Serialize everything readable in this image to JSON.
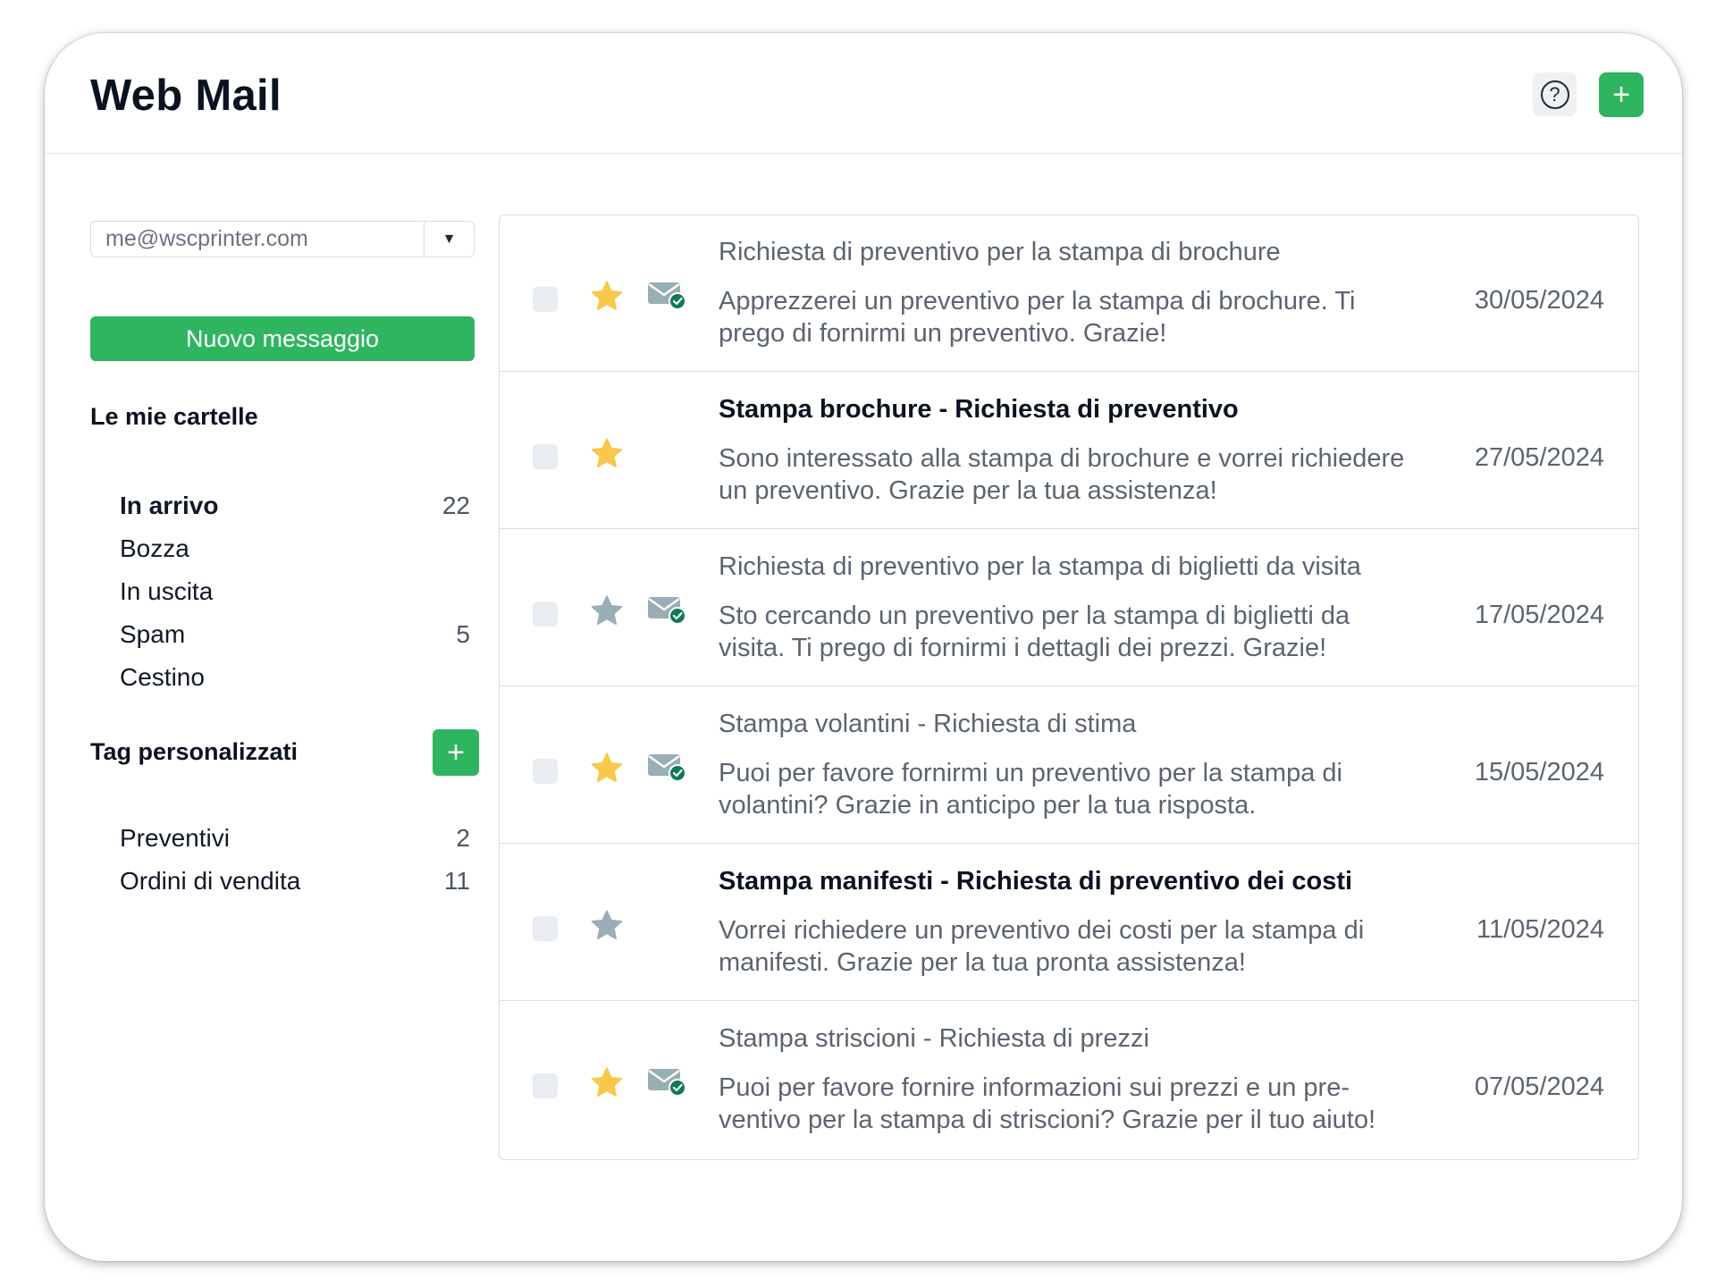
{
  "app": {
    "title": "Web Mail"
  },
  "header": {
    "help_icon": "question-circle-icon",
    "add_icon": "plus-icon",
    "add_label": "+"
  },
  "sidebar": {
    "account": {
      "value": "me@wscprinter.com",
      "caret_icon": "caret-down-icon"
    },
    "compose_label": "Nuovo messaggio",
    "folders_title": "Le mie cartelle",
    "folders": [
      {
        "name": "In arrivo",
        "count": "22",
        "active": true
      },
      {
        "name": "Bozza",
        "count": ""
      },
      {
        "name": "In uscita",
        "count": ""
      },
      {
        "name": "Spam",
        "count": "5"
      },
      {
        "name": "Cestino",
        "count": ""
      }
    ],
    "tags_title": "Tag personalizzati",
    "tags_add_label": "+",
    "tags": [
      {
        "name": "Preventivi",
        "count": "2"
      },
      {
        "name": "Ordini di vendita",
        "count": "11"
      }
    ]
  },
  "colors": {
    "accent_green": "#2fb560",
    "star_yellow": "#f7c84a",
    "star_gray": "#9aaeb5",
    "mail_icon_gray": "#9aaeb5",
    "mail_check_green": "#0f7a55"
  },
  "messages": [
    {
      "subject": "Richiesta di preventivo per la stampa di brochure",
      "preview": "Apprezzerei un preventivo per la stampa di brochure. Ti prego di fornirmi un preventivo. Grazie!",
      "date": "30/05/2024",
      "starred": true,
      "read": true,
      "unread": false
    },
    {
      "subject": "Stampa brochure - Richiesta di preventivo",
      "preview": "Sono interessato alla stampa di brochure e vorrei richiedere un preventivo. Grazie per la tua assistenza!",
      "date": "27/05/2024",
      "starred": true,
      "read": false,
      "unread": true
    },
    {
      "subject": "Richiesta di preventivo per la stampa di biglietti da visita",
      "preview": "Sto cercando un preventivo per la stampa di biglietti da visita. Ti prego di fornirmi i dettagli dei prezzi. Grazie!",
      "date": "17/05/2024",
      "starred": false,
      "read": true,
      "unread": false
    },
    {
      "subject": "Stampa volantini - Richiesta di stima",
      "preview": "Puoi per favore fornirmi un preventivo per la stampa di volantini? Grazie in anticipo per la tua risposta.",
      "date": "15/05/2024",
      "starred": true,
      "read": true,
      "unread": false
    },
    {
      "subject": "Stampa manifesti - Richiesta di preventivo dei costi",
      "preview": "Vorrei richiedere un preventivo dei costi per la stampa di manifesti. Grazie per la tua pronta assistenza!",
      "date": "11/05/2024",
      "starred": false,
      "read": false,
      "unread": true
    },
    {
      "subject": "Stampa striscioni - Richiesta di prezzi",
      "preview": "Puoi per favore fornire informazioni sui prezzi e un pre-ventivo per la stampa di striscioni? Grazie per il tuo aiuto!",
      "date": "07/05/2024",
      "starred": true,
      "read": true,
      "unread": false
    }
  ]
}
